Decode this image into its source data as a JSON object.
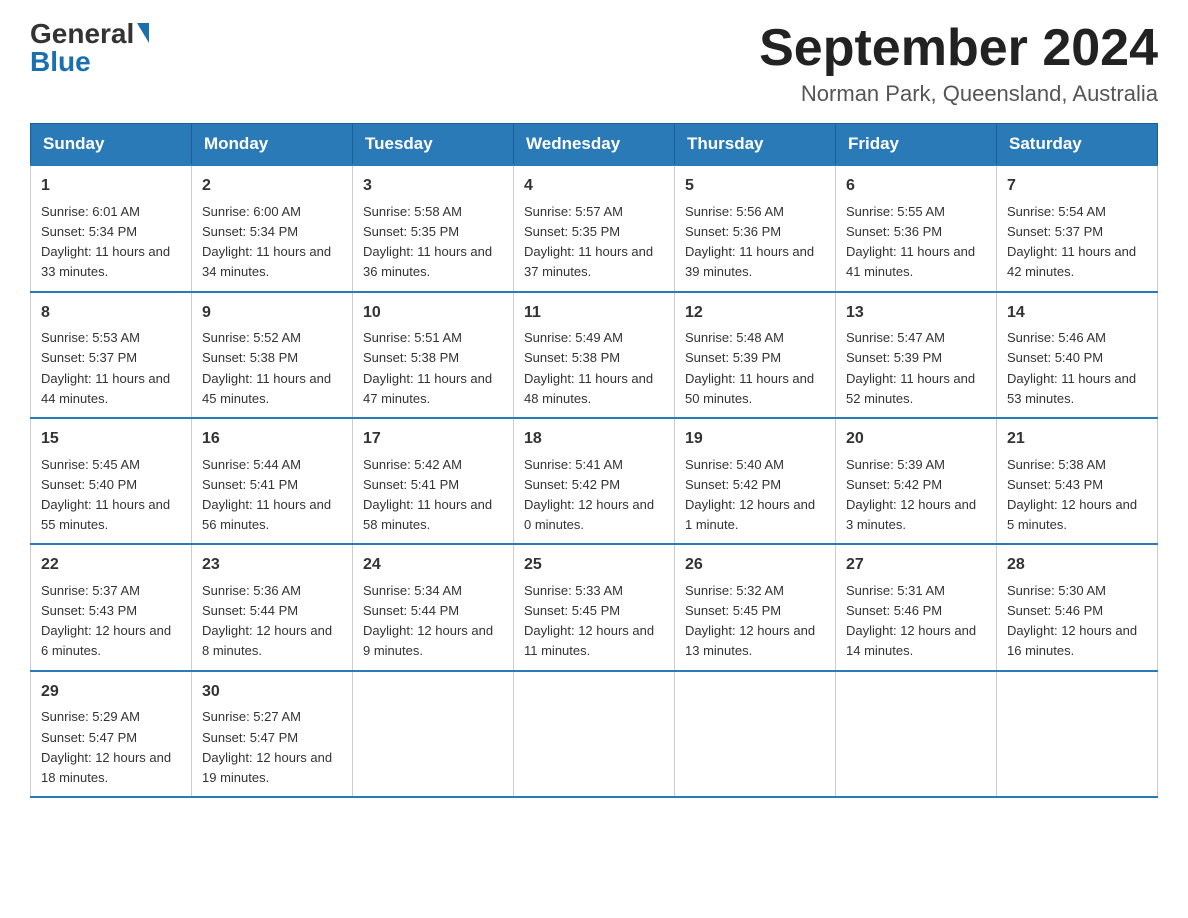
{
  "header": {
    "logo_general": "General",
    "logo_blue": "Blue",
    "month_title": "September 2024",
    "location": "Norman Park, Queensland, Australia"
  },
  "days_header": [
    "Sunday",
    "Monday",
    "Tuesday",
    "Wednesday",
    "Thursday",
    "Friday",
    "Saturday"
  ],
  "weeks": [
    [
      {
        "day": "1",
        "sunrise": "6:01 AM",
        "sunset": "5:34 PM",
        "daylight": "11 hours and 33 minutes."
      },
      {
        "day": "2",
        "sunrise": "6:00 AM",
        "sunset": "5:34 PM",
        "daylight": "11 hours and 34 minutes."
      },
      {
        "day": "3",
        "sunrise": "5:58 AM",
        "sunset": "5:35 PM",
        "daylight": "11 hours and 36 minutes."
      },
      {
        "day": "4",
        "sunrise": "5:57 AM",
        "sunset": "5:35 PM",
        "daylight": "11 hours and 37 minutes."
      },
      {
        "day": "5",
        "sunrise": "5:56 AM",
        "sunset": "5:36 PM",
        "daylight": "11 hours and 39 minutes."
      },
      {
        "day": "6",
        "sunrise": "5:55 AM",
        "sunset": "5:36 PM",
        "daylight": "11 hours and 41 minutes."
      },
      {
        "day": "7",
        "sunrise": "5:54 AM",
        "sunset": "5:37 PM",
        "daylight": "11 hours and 42 minutes."
      }
    ],
    [
      {
        "day": "8",
        "sunrise": "5:53 AM",
        "sunset": "5:37 PM",
        "daylight": "11 hours and 44 minutes."
      },
      {
        "day": "9",
        "sunrise": "5:52 AM",
        "sunset": "5:38 PM",
        "daylight": "11 hours and 45 minutes."
      },
      {
        "day": "10",
        "sunrise": "5:51 AM",
        "sunset": "5:38 PM",
        "daylight": "11 hours and 47 minutes."
      },
      {
        "day": "11",
        "sunrise": "5:49 AM",
        "sunset": "5:38 PM",
        "daylight": "11 hours and 48 minutes."
      },
      {
        "day": "12",
        "sunrise": "5:48 AM",
        "sunset": "5:39 PM",
        "daylight": "11 hours and 50 minutes."
      },
      {
        "day": "13",
        "sunrise": "5:47 AM",
        "sunset": "5:39 PM",
        "daylight": "11 hours and 52 minutes."
      },
      {
        "day": "14",
        "sunrise": "5:46 AM",
        "sunset": "5:40 PM",
        "daylight": "11 hours and 53 minutes."
      }
    ],
    [
      {
        "day": "15",
        "sunrise": "5:45 AM",
        "sunset": "5:40 PM",
        "daylight": "11 hours and 55 minutes."
      },
      {
        "day": "16",
        "sunrise": "5:44 AM",
        "sunset": "5:41 PM",
        "daylight": "11 hours and 56 minutes."
      },
      {
        "day": "17",
        "sunrise": "5:42 AM",
        "sunset": "5:41 PM",
        "daylight": "11 hours and 58 minutes."
      },
      {
        "day": "18",
        "sunrise": "5:41 AM",
        "sunset": "5:42 PM",
        "daylight": "12 hours and 0 minutes."
      },
      {
        "day": "19",
        "sunrise": "5:40 AM",
        "sunset": "5:42 PM",
        "daylight": "12 hours and 1 minute."
      },
      {
        "day": "20",
        "sunrise": "5:39 AM",
        "sunset": "5:42 PM",
        "daylight": "12 hours and 3 minutes."
      },
      {
        "day": "21",
        "sunrise": "5:38 AM",
        "sunset": "5:43 PM",
        "daylight": "12 hours and 5 minutes."
      }
    ],
    [
      {
        "day": "22",
        "sunrise": "5:37 AM",
        "sunset": "5:43 PM",
        "daylight": "12 hours and 6 minutes."
      },
      {
        "day": "23",
        "sunrise": "5:36 AM",
        "sunset": "5:44 PM",
        "daylight": "12 hours and 8 minutes."
      },
      {
        "day": "24",
        "sunrise": "5:34 AM",
        "sunset": "5:44 PM",
        "daylight": "12 hours and 9 minutes."
      },
      {
        "day": "25",
        "sunrise": "5:33 AM",
        "sunset": "5:45 PM",
        "daylight": "12 hours and 11 minutes."
      },
      {
        "day": "26",
        "sunrise": "5:32 AM",
        "sunset": "5:45 PM",
        "daylight": "12 hours and 13 minutes."
      },
      {
        "day": "27",
        "sunrise": "5:31 AM",
        "sunset": "5:46 PM",
        "daylight": "12 hours and 14 minutes."
      },
      {
        "day": "28",
        "sunrise": "5:30 AM",
        "sunset": "5:46 PM",
        "daylight": "12 hours and 16 minutes."
      }
    ],
    [
      {
        "day": "29",
        "sunrise": "5:29 AM",
        "sunset": "5:47 PM",
        "daylight": "12 hours and 18 minutes."
      },
      {
        "day": "30",
        "sunrise": "5:27 AM",
        "sunset": "5:47 PM",
        "daylight": "12 hours and 19 minutes."
      },
      null,
      null,
      null,
      null,
      null
    ]
  ],
  "labels": {
    "sunrise": "Sunrise:",
    "sunset": "Sunset:",
    "daylight": "Daylight:"
  }
}
